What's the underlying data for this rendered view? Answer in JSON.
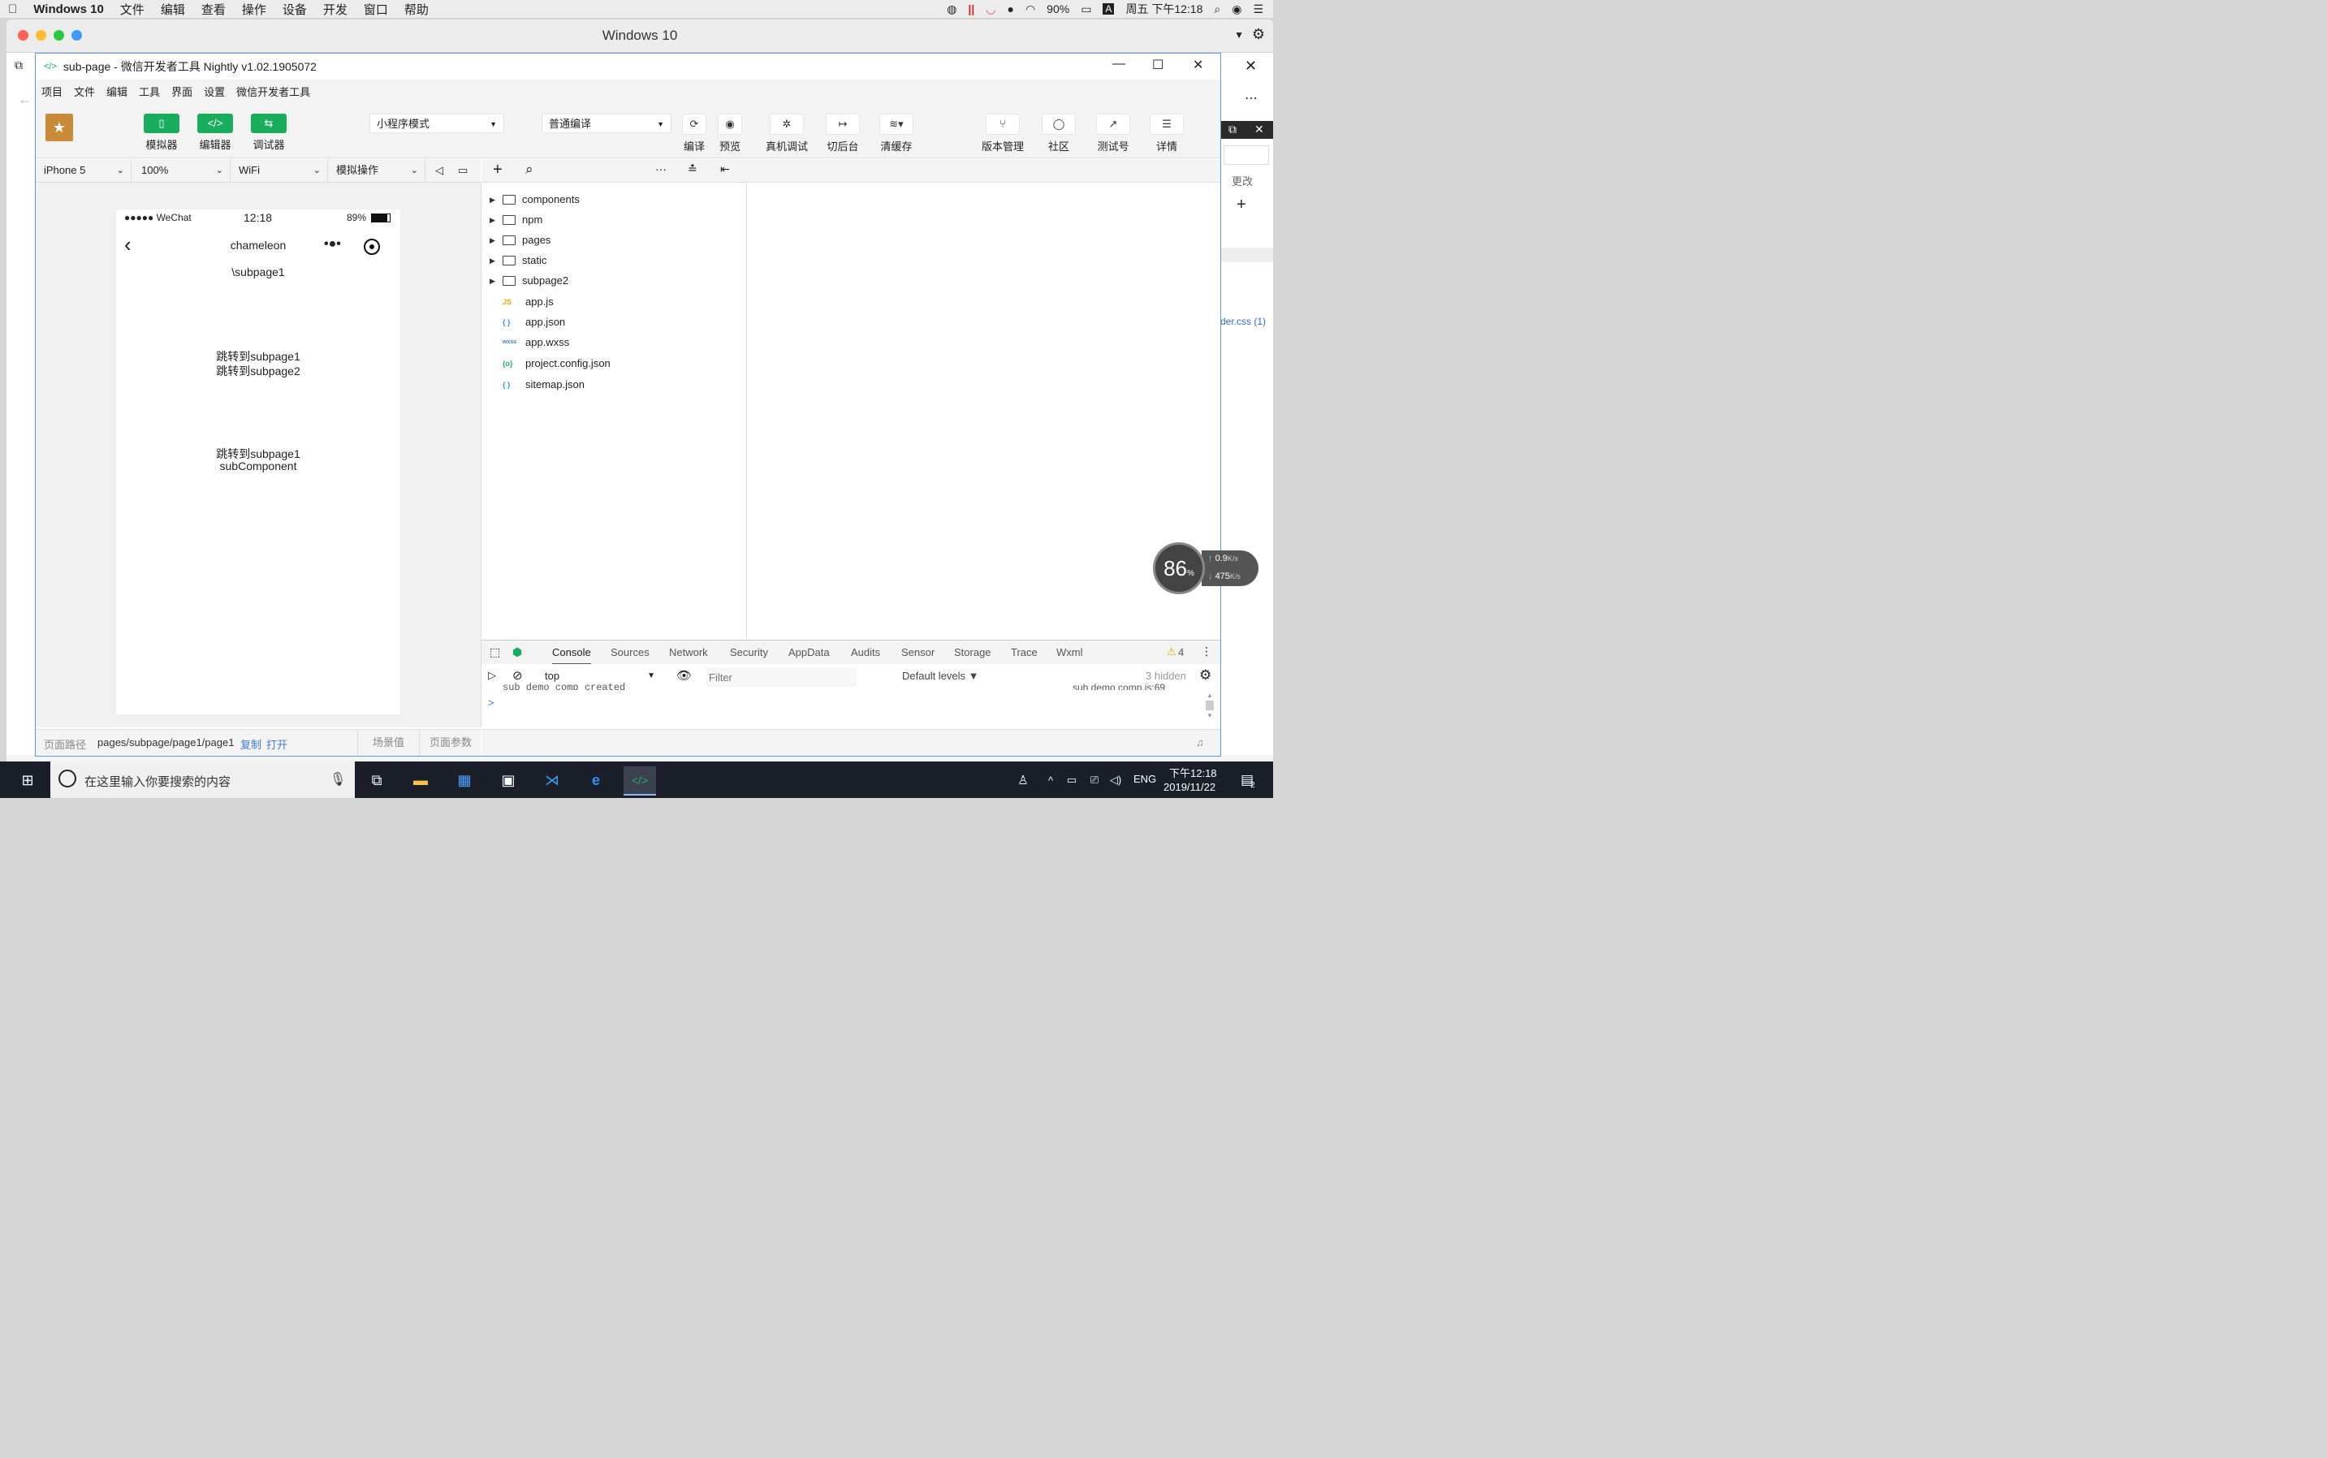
{
  "mac_menubar": {
    "app_name": "Windows 10",
    "menus": [
      "文件",
      "编辑",
      "查看",
      "操作",
      "设备",
      "开发",
      "窗口",
      "帮助"
    ],
    "battery": "90%",
    "input": "A",
    "clock": "周五 下午12:18"
  },
  "vm_window": {
    "title": "Windows 10"
  },
  "app": {
    "title": "sub-page - 微信开发者工具 Nightly v1.02.1905072",
    "menus": [
      "项目",
      "文件",
      "编辑",
      "工具",
      "界面",
      "设置",
      "微信开发者工具"
    ],
    "toolbar": {
      "simulator": "模拟器",
      "editor": "编辑器",
      "debugger": "调试器",
      "mode": "小程序模式",
      "compile_mode": "普通编译",
      "compile": "编译",
      "preview": "预览",
      "real_debug": "真机调试",
      "background": "切后台",
      "clear_cache": "清缓存",
      "version": "版本管理",
      "community": "社区",
      "test_account": "测试号",
      "details": "详情"
    },
    "sim_bar": {
      "device": "iPhone 5",
      "zoom": "100%",
      "network": "WiFi",
      "operation": "模拟操作"
    },
    "phone": {
      "carrier": "●●●●● WeChat",
      "time": "12:18",
      "battery": "89%",
      "nav_title": "chameleon",
      "path_text": "\\subpage1",
      "link1": "跳转到subpage1",
      "link2": "跳转到subpage2",
      "link3": "跳转到subpage1",
      "component": "subComponent"
    },
    "path_bar": {
      "label": "页面路径",
      "path": "pages/subpage/page1/page1",
      "copy": "复制",
      "open": "打开",
      "scene": "场景值",
      "params": "页面参数"
    },
    "file_tree": {
      "folders": [
        "components",
        "npm",
        "pages",
        "static",
        "subpage2"
      ],
      "files": [
        {
          "icon": "JS",
          "name": "app.js",
          "color": "#e8a600"
        },
        {
          "icon": "{ }",
          "name": "app.json",
          "color": "#2b9ad6"
        },
        {
          "icon": "wxss",
          "name": "app.wxss",
          "color": "#3f7bd0"
        },
        {
          "icon": "{o}",
          "name": "project.config.json",
          "color": "#1aad5e"
        },
        {
          "icon": "{ }",
          "name": "sitemap.json",
          "color": "#2b9ad6"
        }
      ]
    },
    "console": {
      "tabs": [
        "Console",
        "Sources",
        "Network",
        "Security",
        "AppData",
        "Audits",
        "Sensor",
        "Storage",
        "Trace",
        "Wxml"
      ],
      "warnings": "4",
      "context": "top",
      "filter_placeholder": "Filter",
      "levels": "Default levels ▼",
      "hidden": "3 hidden",
      "log_text": "sub demo comp created",
      "log_source": "sub demo comp.js:69",
      "prompt": ">"
    }
  },
  "right_partial": {
    "change": "更改",
    "css_file": "der.css (1)"
  },
  "speed_widget": {
    "cpu": "86",
    "unit": "%",
    "up": "0.9",
    "up_unit": "K/s",
    "down": "475",
    "down_unit": "K/s"
  },
  "taskbar": {
    "search_placeholder": "在这里输入你要搜索的内容",
    "lang": "ENG",
    "time": "下午12:18",
    "date": "2019/11/22",
    "notif_count": "2"
  },
  "colors": {
    "accent": "#1aad5e",
    "link": "#3f7bd0",
    "taskbar": "#1a1f2a"
  }
}
